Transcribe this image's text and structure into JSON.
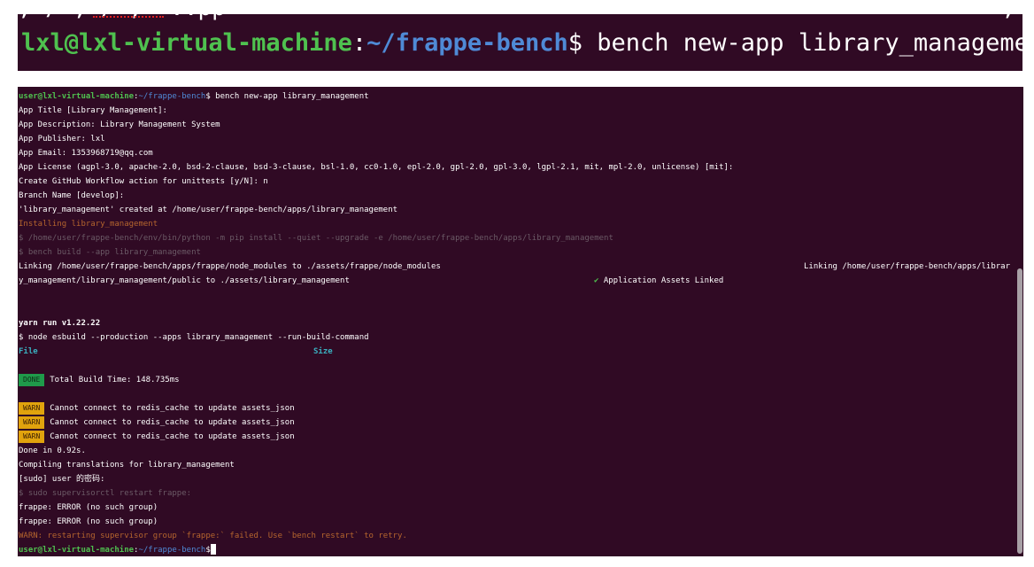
{
  "zoom": {
    "cut_text": "; / , / ;  ..pp                                                        ;",
    "user_host": "lxl@lxl-virtual-machine",
    "colon": ":",
    "path": "~/frappe-bench",
    "prompt_symbol": "$",
    "command": " bench new-app library_management"
  },
  "terminal": {
    "prompt": {
      "user_host": "user@lxl-virtual-machine",
      "colon": ":",
      "path": "~/frappe-bench",
      "symbol": "$"
    },
    "first_command": " bench new-app library_management",
    "lines": {
      "app_title": "App Title [Library Management]:",
      "app_description": "App Description: Library Management System",
      "app_publisher": "App Publisher: lxl",
      "app_email": "App Email: 1353968719@qq.com",
      "app_license": "App License (agpl-3.0, apache-2.0, bsd-2-clause, bsd-3-clause, bsl-1.0, cc0-1.0, epl-2.0, gpl-2.0, gpl-3.0, lgpl-2.1, mit, mpl-2.0, unlicense) [mit]:",
      "create_workflow": "Create GitHub Workflow action for unittests [y/N]: n",
      "branch_name": "Branch Name [develop]:",
      "created_at": "'library_management' created at /home/user/frappe-bench/apps/library_management",
      "installing": "Installing library_management",
      "pip_install": "$ /home/user/frappe-bench/env/bin/python -m pip install --quiet --upgrade -e /home/user/frappe-bench/apps/library_management",
      "bench_build": "$ bench build --app library_management",
      "linking_1": "Linking /home/user/frappe-bench/apps/frappe/node_modules to ./assets/frappe/node_modules",
      "linking_2_right": "Linking /home/user/frappe-bench/apps/librar",
      "linking_2_wrap": "y_management/library_management/public to ./assets/library_management",
      "check_mark": "✔",
      "assets_linked": " Application Assets Linked",
      "yarn_run": "yarn run v1.22.22",
      "node_esbuild": "$ node esbuild --production --apps library_management --run-build-command",
      "col_file": "File",
      "col_size": "Size",
      "done_badge": "DONE",
      "build_time": "Total Build Time: 148.735ms",
      "warn_badge": "WARN",
      "warn_msg": "Cannot connect to redis_cache to update assets_json",
      "done_in": "Done in 0.92s.",
      "compiling": "Compiling translations for library_management",
      "sudo_prompt": "[sudo] user 的密码:",
      "supervisorctl": "$ sudo supervisorctl restart frappe:",
      "frappe_error": "frappe: ERROR (no such group)",
      "warn_restart": "WARN: restarting supervisor group `frappe:` failed. Use `bench restart` to retry."
    }
  }
}
